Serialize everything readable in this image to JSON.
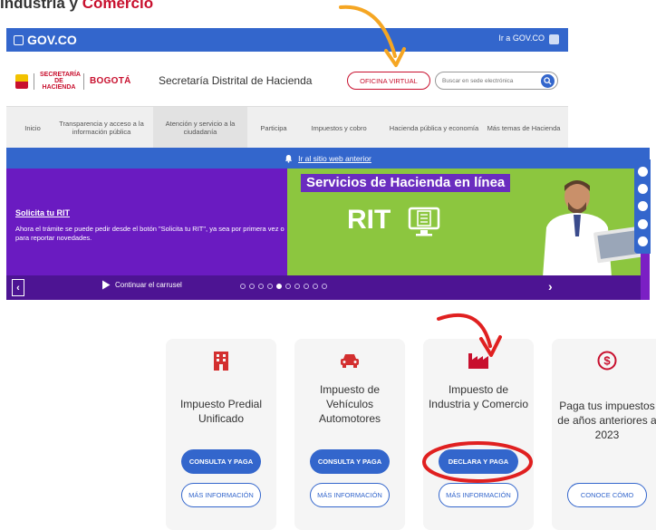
{
  "caption": {
    "before": "Industria y ",
    "accent": "Comercio"
  },
  "gov_bar": {
    "logo_text": "GOV.CO",
    "link": "Ir a GOV.CO"
  },
  "header": {
    "logo_hacienda": "SECRETARÍA DE HACIENDA",
    "logo_bogota": "BOGOTÁ",
    "title": "Secretaría Distrital de Hacienda",
    "virtual_office_button": "OFICINA VIRTUAL",
    "search_placeholder": "Buscar en sede electrónica"
  },
  "nav": {
    "items": [
      {
        "label": "Inicio"
      },
      {
        "label": "Transparencia y acceso a la información pública"
      },
      {
        "label": "Atención y servicio a la ciudadanía"
      },
      {
        "label": "Participa"
      },
      {
        "label": "Impuestos y cobro"
      },
      {
        "label": "Hacienda pública y economía"
      },
      {
        "label": "Más temas de Hacienda"
      }
    ]
  },
  "previous_site": {
    "label": "Ir al sitio web anterior"
  },
  "carousel": {
    "slide_title": "Solicita tu RIT",
    "slide_text": "Ahora el trámite se puede pedir desde el botón \"Solicita tu RIT\", ya sea por primera vez o para reportar novedades.",
    "banner_title": "Servicios de Hacienda en línea",
    "banner_word": "RIT",
    "play_label": "Continuar el carrusel",
    "slide_count": 10,
    "active_slide": 5
  },
  "cards": [
    {
      "title": "Impuesto Predial Unificado",
      "primary": "CONSULTA Y PAGA",
      "secondary": "MÁS INFORMACIÓN",
      "icon": "building-icon"
    },
    {
      "title": "Impuesto de Vehículos Automotores",
      "primary": "CONSULTA Y PAGA",
      "secondary": "MÁS INFORMACIÓN",
      "icon": "car-icon"
    },
    {
      "title": "Impuesto de Industria y Comercio",
      "primary": "DECLARA Y PAGA",
      "secondary": "MÁS INFORMACIÓN",
      "icon": "factory-icon"
    },
    {
      "title": "Paga tus impuestos de años anteriores a 2023",
      "secondary": "CONOCE CÓMO",
      "icon": "dollar-coin-icon"
    }
  ],
  "colors": {
    "gov_blue": "#3366cc",
    "hacienda_red": "#c8102e",
    "carousel_purple": "#6a1bc1",
    "banner_green": "#8cc63f",
    "annotation_orange": "#f5a623"
  }
}
